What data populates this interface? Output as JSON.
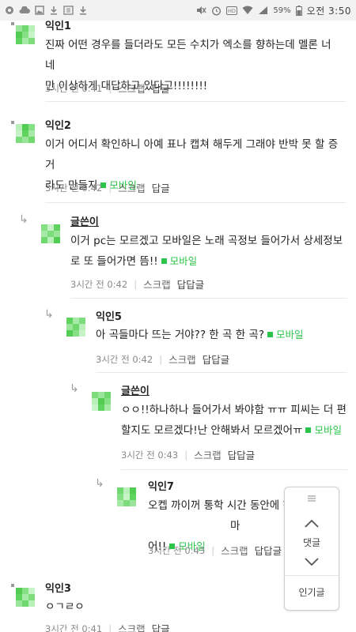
{
  "status_bar": {
    "battery": "59%",
    "time": "오전 3:50"
  },
  "comments": [
    {
      "author": "익인1",
      "lines": [
        "진짜 어떤 경우를 들더라도 모든 수치가 엑소를 향하는데 멜론 너네",
        "만 이상하게 대답하고 있다고!!!!!!!!"
      ],
      "mobile": false,
      "time": "3시간 전 0:41",
      "scrap": "스크랩",
      "reply": "답글"
    },
    {
      "author": "익인2",
      "lines": [
        "이거 어디서 확인하니 아예 표나 캡쳐 해두게 그래야 반박 못 할 증거",
        "라도 만들지"
      ],
      "mobile": true,
      "mobile_label": "모바일",
      "time": "3시간 전 0:42",
      "scrap": "스크랩",
      "reply": "답글"
    },
    {
      "author": "글쓴이",
      "lines": [
        "이거 pc는 모르겠고 모바일은 노래 곡정보 들어가서 상세정보",
        "로 또 들어가면 뜸!!"
      ],
      "mobile": true,
      "mobile_label": "모바일",
      "time": "3시간 전 0:42",
      "scrap": "스크랩",
      "reply": "답답글"
    },
    {
      "author": "익인5",
      "lines": [
        "아 곡들마다 뜨는 거야?? 한 곡 한 곡?"
      ],
      "mobile": true,
      "mobile_label": "모바일",
      "time": "3시간 전 0:42",
      "scrap": "스크랩",
      "reply": "답답글"
    },
    {
      "author": "글쓴이",
      "lines": [
        "ㅇㅇ!!하나하나 들어가서 봐야함 ㅠㅠ 피씨는 더 편",
        "할지도 모르겠다!난 안해봐서 모르겠어ㅠ"
      ],
      "mobile": true,
      "mobile_label": "모바일",
      "time": "3시간 전 0:43",
      "scrap": "스크랩",
      "reply": "답답글"
    },
    {
      "author": "익인7",
      "lines": [
        "오켑 까이꺼 통학 시간 동안에 하",
        "어!!"
      ],
      "mobile": true,
      "mobile_label": "모바일",
      "time": "3시간 전 0:43",
      "scrap": "스크랩",
      "reply": "답답글"
    },
    {
      "author": "익인3",
      "lines": [
        "ㅇㄱㄹㅇ"
      ],
      "mobile": false,
      "time": "3시간 전 0:41",
      "scrap": "스크랩",
      "reply": "답글"
    }
  ],
  "float_nav": {
    "comments_label": "댓글",
    "popular_label": "인기글"
  }
}
